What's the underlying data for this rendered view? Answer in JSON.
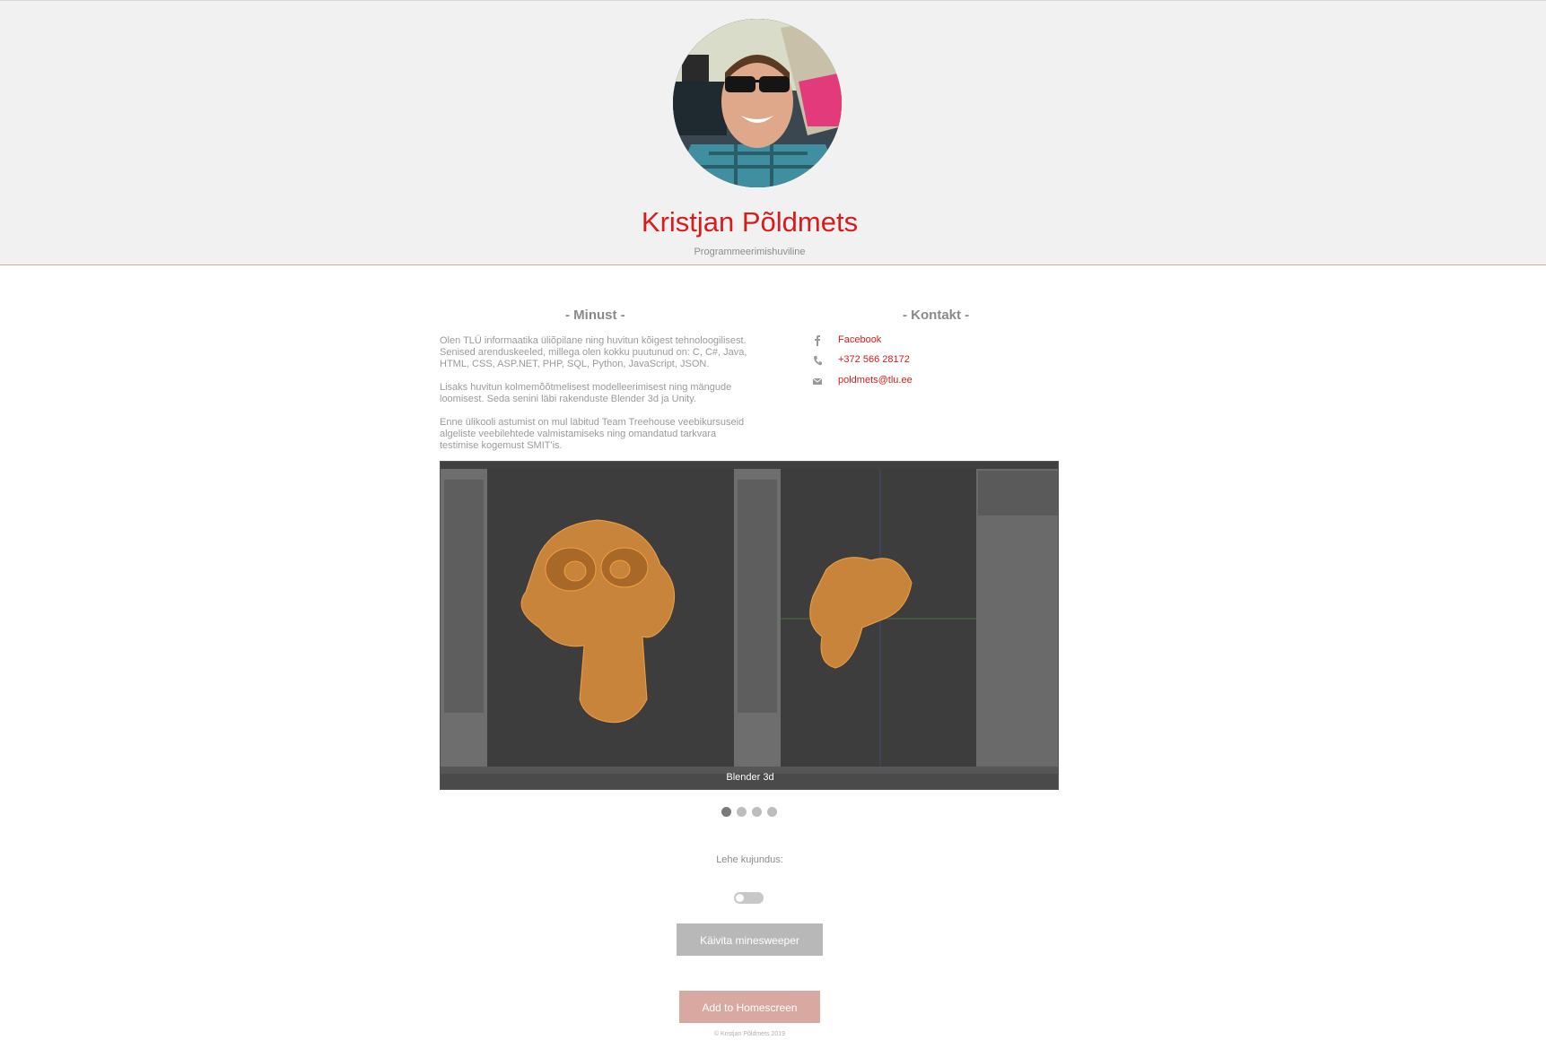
{
  "profile": {
    "name": "Kristjan Põldmets",
    "subtitle": "Programmeerimishuviline"
  },
  "about": {
    "title": "- Minust -",
    "paragraphs": [
      "Olen TLÜ informaatika üliõpilane ning huvitun kõigest tehnoloogilisest. Senised arenduskeeled, millega olen kokku puutunud on: C, C#, Java, HTML, CSS, ASP.NET, PHP, SQL, Python, JavaScript, JSON.",
      "Lisaks huvitun kolmemõõtmelisest modelleerimisest ning mängude loomisest. Seda senini läbi rakenduste Blender 3d ja Unity.",
      "Enne ülikooli astumist on mul läbitud Team Treehouse veebikursuseid algeliste veebilehtede valmistamiseks ning omandatud tarkvara testimise kogemust SMIT'is."
    ]
  },
  "contact": {
    "title": "- Kontakt -",
    "items": [
      {
        "icon": "facebook-icon",
        "text": "Facebook"
      },
      {
        "icon": "phone-icon",
        "text": "+372 566 28172"
      },
      {
        "icon": "email-icon",
        "text": "poldmets@tlu.ee"
      }
    ]
  },
  "slider": {
    "caption": "Blender 3d",
    "slide_count": 4,
    "active_index": 0
  },
  "design": {
    "label": "Lehe kujundus:"
  },
  "buttons": {
    "minesweeper": "Käivita minesweeper",
    "homescreen": "Add to Homescreen"
  },
  "footer": {
    "text": "© Kristjan Põldmets 2019"
  },
  "colors": {
    "accent": "#d91b1b",
    "header_bg": "#f1f1f1",
    "homescreen_button": "#d7a9a0",
    "minesweeper_button": "#b8b8b8"
  }
}
